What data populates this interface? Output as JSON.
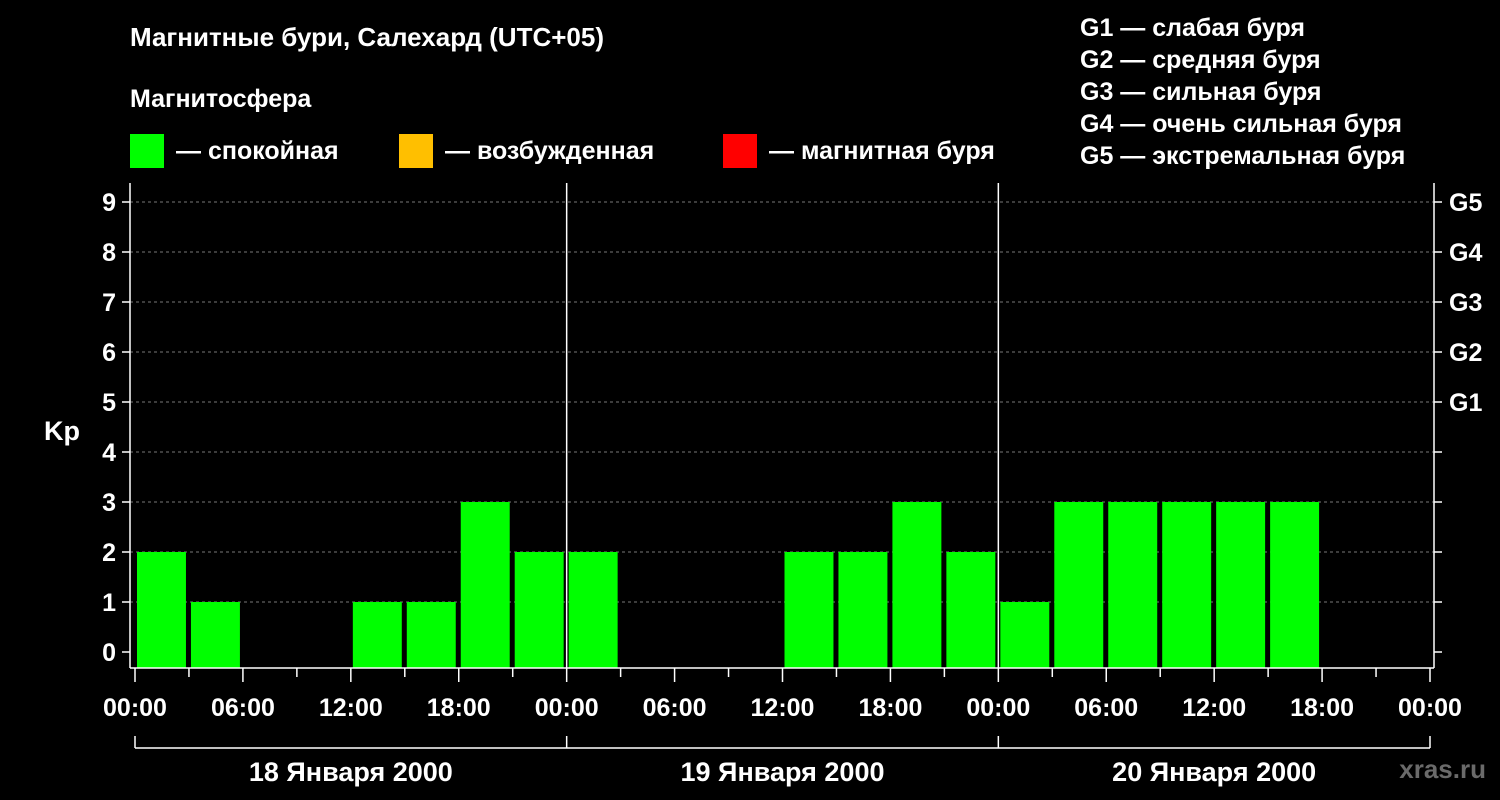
{
  "title": "Магнитные бури, Салехард (UTC+05)",
  "subtitle": "Магнитосфера",
  "legend": [
    {
      "color": "#00ff00",
      "label": "— спокойная"
    },
    {
      "color": "#ffbf00",
      "label": "— возбужденная"
    },
    {
      "color": "#ff0000",
      "label": "— магнитная буря"
    }
  ],
  "storm_scale": [
    "G1 — слабая буря",
    "G2 — средняя буря",
    "G3 — сильная буря",
    "G4 — очень сильная буря",
    "G5 — экстремальная буря"
  ],
  "watermark": "xras.ru",
  "chart_data": {
    "type": "bar",
    "ylabel": "Kp",
    "ylim": [
      0,
      9
    ],
    "y_ticks": [
      "0",
      "1",
      "2",
      "3",
      "4",
      "5",
      "6",
      "7",
      "8",
      "9"
    ],
    "right_axis": [
      {
        "kp": 5,
        "label": "G1"
      },
      {
        "kp": 6,
        "label": "G2"
      },
      {
        "kp": 7,
        "label": "G3"
      },
      {
        "kp": 8,
        "label": "G4"
      },
      {
        "kp": 9,
        "label": "G5"
      }
    ],
    "x_tick_labels": [
      "00:00",
      "06:00",
      "12:00",
      "18:00",
      "00:00",
      "06:00",
      "12:00",
      "18:00",
      "00:00",
      "06:00",
      "12:00",
      "18:00",
      "00:00"
    ],
    "days": [
      "18 Января 2000",
      "19 Января 2000",
      "20 Января 2000"
    ],
    "interval_hours": 3,
    "grid": true,
    "series": [
      {
        "values": [
          2,
          1,
          0,
          0,
          1,
          1,
          3,
          2,
          2,
          0,
          0,
          0,
          2,
          2,
          3,
          2,
          1,
          3,
          3,
          3,
          3,
          3
        ],
        "color": "#00ff00"
      }
    ]
  }
}
